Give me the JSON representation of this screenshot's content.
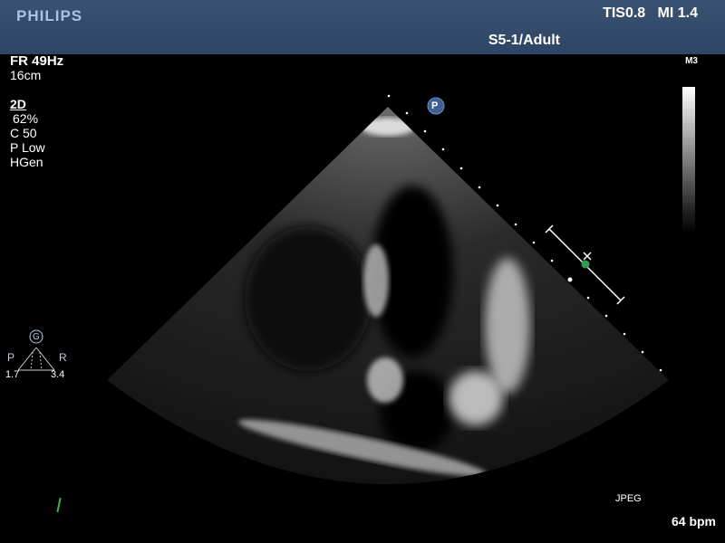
{
  "header": {
    "brand": "PHILIPS",
    "safety_indices": "TIS0.8   MI 1.4",
    "transducer_preset": "S5-1/Adult"
  },
  "imaging_params": {
    "frame_rate": "FR 49Hz",
    "depth": "16cm",
    "mode": "2D",
    "gain": "62%",
    "compression": "C 50",
    "persistence": "P Low",
    "harmonics": "HGen"
  },
  "gray_map": {
    "label": "M3"
  },
  "focus_widget": {
    "icon": "g-circle-icon",
    "left_label": "P",
    "right_label": "R",
    "left_value": "1.7",
    "right_value": "3.4"
  },
  "orientation_marker": {
    "text": "P",
    "color": "#3d5f93"
  },
  "footer": {
    "format": "JPEG",
    "heart_rate": "64 bpm"
  },
  "colors": {
    "header_bg": "#2e4565",
    "brand_text": "#a9c3e6",
    "focus_dot": "#2f9a4f"
  }
}
